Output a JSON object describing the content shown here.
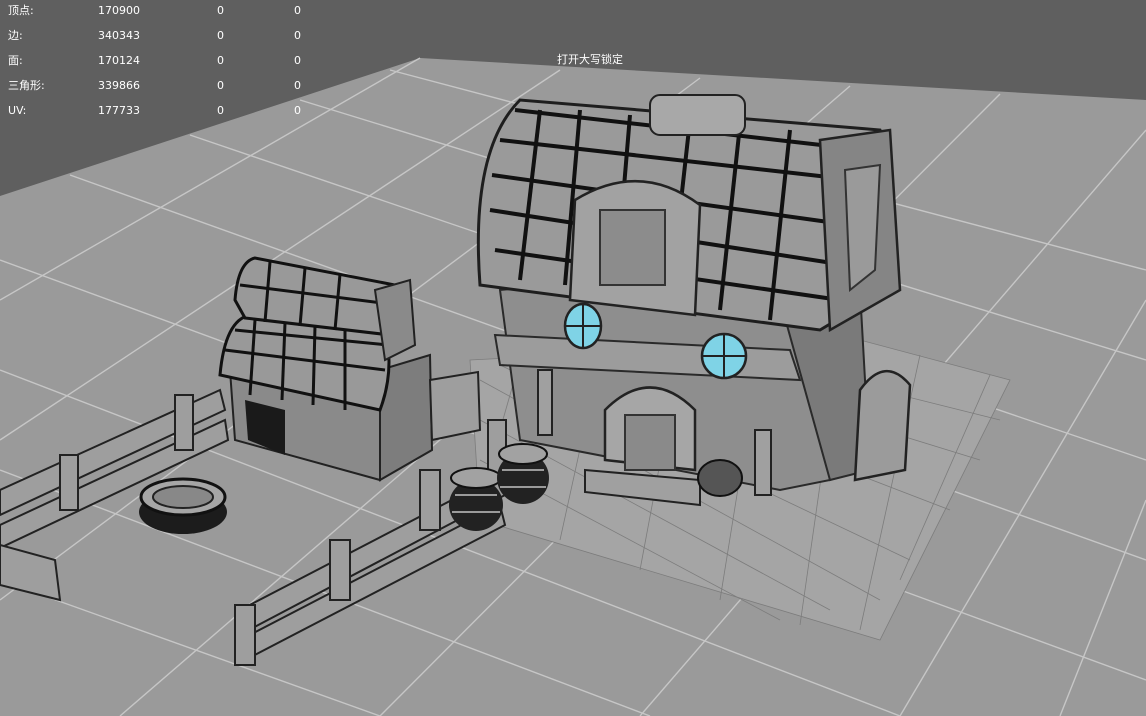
{
  "hud": {
    "rows": [
      {
        "label": "顶点:",
        "v1": "170900",
        "v2": "0",
        "v3": "0"
      },
      {
        "label": "边:",
        "v1": "340343",
        "v2": "0",
        "v3": "0"
      },
      {
        "label": "面:",
        "v1": "170124",
        "v2": "0",
        "v3": "0"
      },
      {
        "label": "三角形:",
        "v1": "339866",
        "v2": "0",
        "v3": "0"
      },
      {
        "label": "UV:",
        "v1": "177733",
        "v2": "0",
        "v3": "0"
      }
    ]
  },
  "viewport": {
    "message": "打开大写锁定",
    "background_color": "#5f5f5f",
    "ground_color": "#9a9a9a",
    "grid_color": "#c8c8c8",
    "window_glass_color": "#7fd3e6"
  }
}
